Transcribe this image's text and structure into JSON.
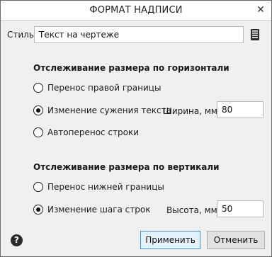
{
  "dialog": {
    "title": "ФОРМАТ НАДПИСИ",
    "close_icon": "close-icon"
  },
  "style": {
    "label": "Стиль:",
    "value": "Текст на чертеже",
    "library_icon": "book-icon"
  },
  "horizontal": {
    "title": "Отслеживание размера по горизонтали",
    "options": [
      {
        "label": "Перенос правой границы",
        "checked": false
      },
      {
        "label": "Изменение сужения текста",
        "checked": true
      },
      {
        "label": "Автоперенос строки",
        "checked": false
      }
    ],
    "width_label": "Ширина, мм:",
    "width_value": "80"
  },
  "vertical": {
    "title": "Отслеживание размера по вертикали",
    "options": [
      {
        "label": "Перенос нижней границы",
        "checked": false
      },
      {
        "label": "Изменение шага строк",
        "checked": true
      }
    ],
    "height_label": "Высота, мм:",
    "height_value": "50"
  },
  "footer": {
    "help_icon": "help-icon",
    "apply_label": "Применить",
    "cancel_label": "Отменить"
  }
}
